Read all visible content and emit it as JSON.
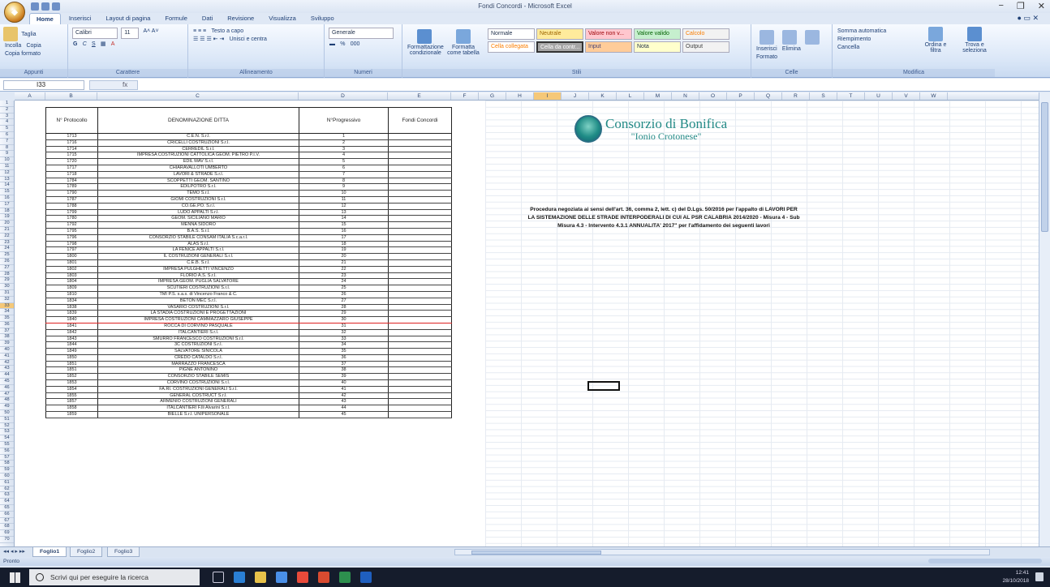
{
  "window": {
    "title": "Fondi Concordi - Microsoft Excel",
    "quick_access": [
      "save-icon",
      "undo-icon",
      "redo-icon"
    ],
    "controls": {
      "minimize": "−",
      "maximize": "❐",
      "close": "✕"
    }
  },
  "ribbon": {
    "tabs": [
      "Home",
      "Inserisci",
      "Layout di pagina",
      "Formule",
      "Dati",
      "Revisione",
      "Visualizza",
      "Sviluppo"
    ],
    "active_tab": "Home",
    "groups": [
      {
        "label": "Appunti",
        "items": [
          "Incolla",
          "Taglia",
          "Copia",
          "Copia formato"
        ]
      },
      {
        "label": "Carattere",
        "items": [
          "Calibri",
          "11",
          "G",
          "C",
          "S"
        ]
      },
      {
        "label": "Allineamento",
        "items": [
          "Testo a capo",
          "Unisci e centra"
        ]
      },
      {
        "label": "Numeri",
        "items": [
          "Generale",
          "%",
          "000"
        ]
      },
      {
        "label": "Stili",
        "items": [
          "Formattazione condizionale",
          "Formatta come tabella",
          "Normale",
          "Neutrale",
          "Valore non v...",
          "Valore valido",
          "Calcolo",
          "Cella collegata",
          "Cella da contr...",
          "Input",
          "Nota",
          "Output"
        ]
      },
      {
        "label": "Celle",
        "items": [
          "Inserisci",
          "Elimina",
          "Formato"
        ]
      },
      {
        "label": "Modifica",
        "items": [
          "Somma automatica",
          "Riempimento",
          "Cancella",
          "Ordina e filtra",
          "Trova e seleziona"
        ]
      }
    ]
  },
  "formula_bar": {
    "name_box": "I33",
    "fx": "fx",
    "content": ""
  },
  "columns": [
    "A",
    "B",
    "C",
    "D",
    "E",
    "F",
    "G",
    "H",
    "I",
    "J",
    "K",
    "L",
    "M",
    "N",
    "O",
    "P",
    "Q",
    "R",
    "S",
    "T",
    "U",
    "V",
    "W"
  ],
  "selected_column": "I",
  "selected_row": 33,
  "row_count": 44,
  "table": {
    "headers": [
      "N° Protocollo",
      "DENOMINAZIONE DITTA",
      "N°Progressivo",
      "Fondi Concordi"
    ],
    "rows": [
      [
        "1713",
        "C.E.N. S.r.l.",
        "1",
        ""
      ],
      [
        "1716",
        "CRICELLI COSTRUZIONI S.r.l.",
        "2",
        ""
      ],
      [
        "1714",
        "CERREDIL S.r.l.",
        "3",
        ""
      ],
      [
        "1715",
        "IMPRESA COSTRUZIONI CATTOLICA GEOM. PIETRO P.I.V.",
        "4",
        ""
      ],
      [
        "1720",
        "EDIL MAV S.r.l.",
        "5",
        ""
      ],
      [
        "1717",
        "CHIARAVALLOTI UMBERTO",
        "6",
        ""
      ],
      [
        "1718",
        "LAVORI & STRADE S.r.l.",
        "7",
        ""
      ],
      [
        "1784",
        "SCOPPETTI GEOM. SANTINO",
        "8",
        ""
      ],
      [
        "1789",
        "EDILPOTRO S.r.l.",
        "9",
        ""
      ],
      [
        "1790",
        "TEMO S.r.l.",
        "10",
        ""
      ],
      [
        "1787",
        "GIOMI COSTRUZIONI S.r.l.",
        "11",
        ""
      ],
      [
        "1788",
        "CO.GE.PO. S.r.l.",
        "12",
        ""
      ],
      [
        "1799",
        "LUDO APPALTI S.r.l.",
        "13",
        ""
      ],
      [
        "1780",
        "GEOM. SICILIANO MARIO",
        "14",
        ""
      ],
      [
        "1792",
        "MENNA SIDORO",
        "15",
        ""
      ],
      [
        "1795",
        "B.A.S. S.r.l.",
        "16",
        ""
      ],
      [
        "1796",
        "CONSORZIO STABILE CONSAM ITALIA S.c.a.r.l.",
        "17",
        ""
      ],
      [
        "1798",
        "ALAS S.r.l.",
        "18",
        ""
      ],
      [
        "1797",
        "LA FENICE APPALTI S.r.l.",
        "19",
        ""
      ],
      [
        "1800",
        "IL COSTRUZIONI GENERALI S.r.l.",
        "20",
        ""
      ],
      [
        "1801",
        "C.E.B. S.r.l.",
        "21",
        ""
      ],
      [
        "1802",
        "IMPRESA PULGHETTI VINCENZO",
        "22",
        ""
      ],
      [
        "1803",
        "FLORIO A.S. S.r.l.",
        "23",
        ""
      ],
      [
        "1804",
        "IMPRESA GEOM. PUGLIA SALVATORE",
        "24",
        ""
      ],
      [
        "1809",
        "SCUTIERI COSTRUZIONI S.r.l.",
        "25",
        ""
      ],
      [
        "1810",
        "TMI P.S. s.a.s. di Vincenzo Franco & C.",
        "26",
        ""
      ],
      [
        "1834",
        "BETON MEC S.r.l.",
        "27",
        ""
      ],
      [
        "1838",
        "VASARIO COSTRUZIONI S.r.l.",
        "28",
        ""
      ],
      [
        "1839",
        "LA STADIA COSTRUZIONI E PROGETTAZIONI",
        "29",
        ""
      ],
      [
        "1840",
        "IMPRESA COSTRUZIONI CAMMAZZARO GIUSEPPE",
        "30",
        ""
      ],
      [
        "1841",
        "ROCCA DI CORVINO PASQUALE",
        "31",
        ""
      ],
      [
        "1842",
        "ITALCANTIERI S.r.l.",
        "32",
        ""
      ],
      [
        "1843",
        "SMURRO FRANCESCO COSTRUZIONI S.r.l.",
        "33",
        ""
      ],
      [
        "1844",
        "3C COSTRUZIONI S.r.l.",
        "34",
        ""
      ],
      [
        "1849",
        "SALVATORE SINICOLA",
        "35",
        ""
      ],
      [
        "1850",
        "CREDO CATALDO S.r.l.",
        "36",
        ""
      ],
      [
        "1851",
        "MARRAZZO FRANCESCA",
        "37",
        ""
      ],
      [
        "1851",
        "PIGNE ANTONINO",
        "38",
        ""
      ],
      [
        "1852",
        "CONSORZIO STABILE SEMIS",
        "39",
        ""
      ],
      [
        "1853",
        "CORVINO COSTRUZIONI S.r.l.",
        "40",
        ""
      ],
      [
        "1854",
        "FA.RI. COSTRUZIONI GENERALI S.r.l.",
        "41",
        ""
      ],
      [
        "1855",
        "GENERAL COSTRUCT S.r.l.",
        "42",
        ""
      ],
      [
        "1857",
        "ARMENIO COSTRUZIONI GENERALI",
        "43",
        ""
      ],
      [
        "1858",
        "ITALCANTIERI F.lli Alvarini S.r.l.",
        "44",
        ""
      ],
      [
        "1859",
        "BIELLE S.r.l. UNIPERSONALE",
        "45",
        ""
      ]
    ]
  },
  "logo": {
    "line1": "Consorzio di Bonifica",
    "line2": "\"Ionio Crotonese\""
  },
  "description": "Procedura negoziata ai sensi dell'art. 36, comma 2, lett. c) del D.Lgs. 50/2016 per l'appalto di LAVORI PER LA SISTEMAZIONE DELLE STRADE INTERPODERALI DI CUI AL PSR CALABRIA 2014/2020 - Misura 4 - Sub Misura 4.3 - Intervento 4.3.1 ANNUALITA' 2017\" per l'affidamento dei seguenti lavori",
  "sheet_tabs": [
    "Foglio1",
    "Foglio2",
    "Foglio3"
  ],
  "active_sheet": "Foglio1",
  "status": {
    "text": "Pronto"
  },
  "taskbar": {
    "search_placeholder": "Scrivi qui per eseguire la ricerca",
    "tray_time": "12:41",
    "tray_date": "28/10/2018"
  },
  "colors": {
    "ribbon": "#d9e6f7",
    "accent": "#f5c878",
    "logo": "#238a86",
    "taskbar": "#151c2c"
  }
}
